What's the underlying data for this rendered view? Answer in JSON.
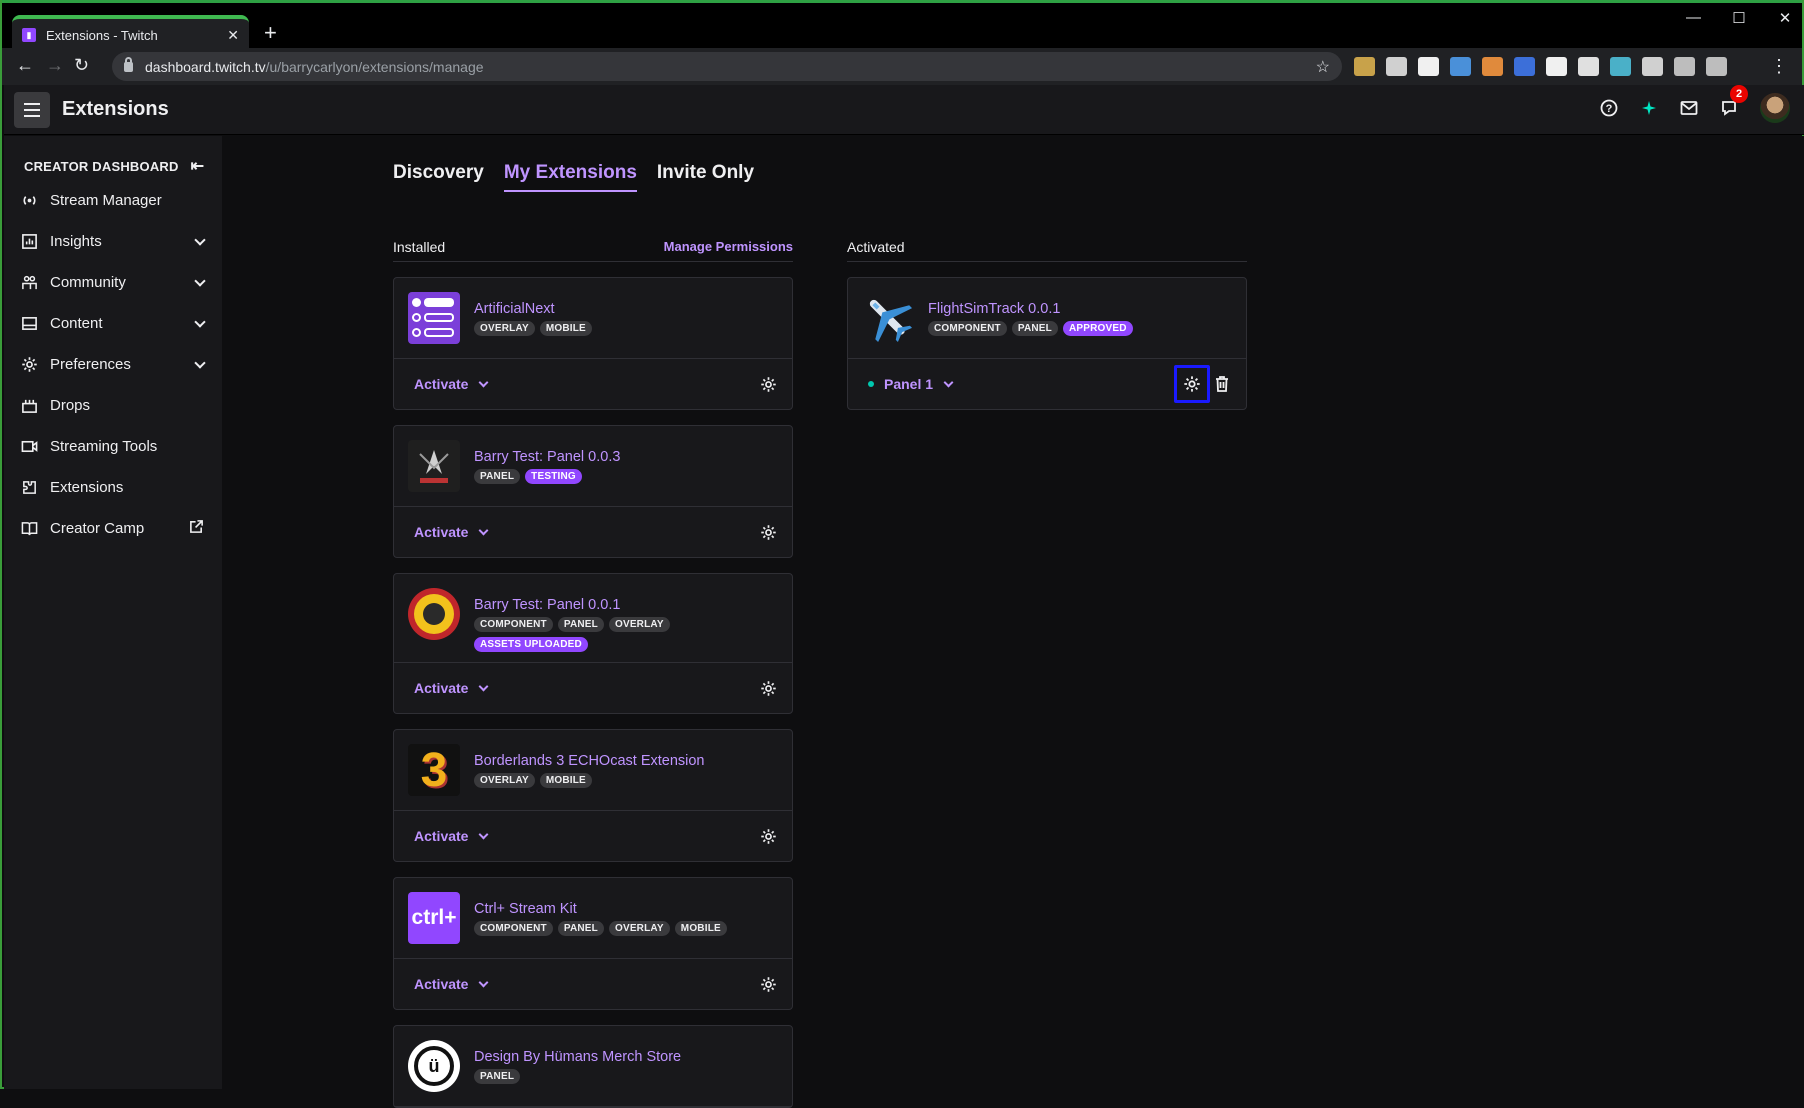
{
  "browser": {
    "tab_title": "Extensions - Twitch",
    "url_host": "dashboard.twitch.tv",
    "url_path": "/u/barrycarlyon/extensions/manage",
    "extension_icon_colors": [
      "#c8a24a",
      "#d0d0d0",
      "#f0f0f0",
      "#4a90d9",
      "#e08a3c",
      "#3c6fd9",
      "#f0f0f0",
      "#e0e0e0",
      "#4ab0c8",
      "#d0d0d0",
      "#bdbdbd",
      "#bdbdbd"
    ]
  },
  "topnav": {
    "title": "Extensions",
    "notification_count": "2"
  },
  "sidebar": {
    "heading": "CREATOR DASHBOARD",
    "items": [
      {
        "label": "Stream Manager",
        "icon": "broadcast-icon",
        "has_chevron": false
      },
      {
        "label": "Insights",
        "icon": "chart-icon",
        "has_chevron": true
      },
      {
        "label": "Community",
        "icon": "people-icon",
        "has_chevron": true
      },
      {
        "label": "Content",
        "icon": "content-icon",
        "has_chevron": true
      },
      {
        "label": "Preferences",
        "icon": "gear-icon",
        "has_chevron": true
      },
      {
        "label": "Drops",
        "icon": "drops-icon",
        "has_chevron": false
      },
      {
        "label": "Streaming Tools",
        "icon": "camera-icon",
        "has_chevron": false
      },
      {
        "label": "Extensions",
        "icon": "puzzle-icon",
        "has_chevron": false
      },
      {
        "label": "Creator Camp",
        "icon": "book-icon",
        "has_chevron": false,
        "external": true
      }
    ]
  },
  "tabs": [
    "Discovery",
    "My Extensions",
    "Invite Only"
  ],
  "installed": {
    "label": "Installed",
    "link": "Manage Permissions",
    "action_label": "Activate",
    "cards": [
      {
        "name": "ArtificialNext",
        "tags": [
          {
            "t": "OVERLAY"
          },
          {
            "t": "MOBILE"
          }
        ]
      },
      {
        "name": "Barry Test: Panel 0.0.3",
        "tags": [
          {
            "t": "PANEL"
          },
          {
            "t": "TESTING",
            "purple": true
          }
        ]
      },
      {
        "name": "Barry Test: Panel 0.0.1",
        "tags": [
          {
            "t": "COMPONENT"
          },
          {
            "t": "PANEL"
          },
          {
            "t": "OVERLAY"
          },
          {
            "t": "ASSETS UPLOADED",
            "purple": true
          }
        ]
      },
      {
        "name": "Borderlands 3 ECHOcast Extension",
        "tags": [
          {
            "t": "OVERLAY"
          },
          {
            "t": "MOBILE"
          }
        ]
      },
      {
        "name": "Ctrl+ Stream Kit",
        "logo_text": "ctrl+",
        "tags": [
          {
            "t": "COMPONENT"
          },
          {
            "t": "PANEL"
          },
          {
            "t": "OVERLAY"
          },
          {
            "t": "MOBILE"
          }
        ]
      },
      {
        "name": "Design By Hümans Merch Store",
        "tags": [
          {
            "t": "PANEL"
          }
        ]
      }
    ]
  },
  "activated": {
    "label": "Activated",
    "card": {
      "name": "FlightSimTrack 0.0.1",
      "tags": [
        {
          "t": "COMPONENT"
        },
        {
          "t": "PANEL"
        },
        {
          "t": "APPROVED",
          "purple": true
        }
      ],
      "slot": "Panel 1"
    }
  },
  "colors": {
    "accent": "#bf94ff",
    "brand": "#9147ff",
    "bg": "#0e0e10",
    "panel": "#18181b",
    "highlight": "#1a1aff"
  }
}
